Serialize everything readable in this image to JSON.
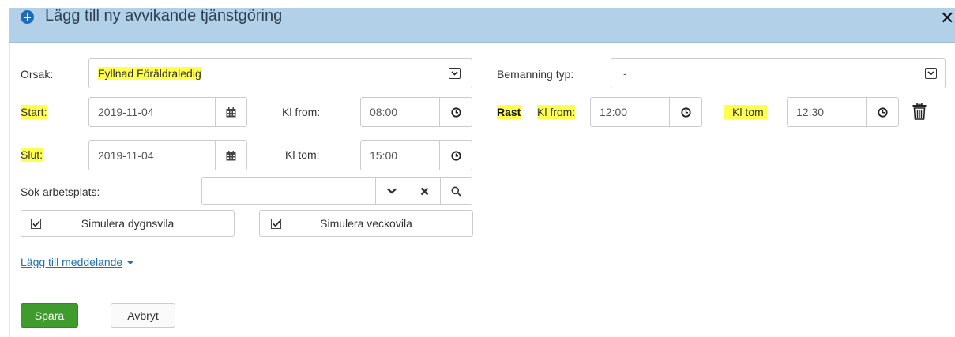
{
  "dialog": {
    "title": "Lägg till ny avvikande tjänstgöring",
    "close_glyph": "✕"
  },
  "form": {
    "orsak_label": "Orsak:",
    "orsak_value": "Fyllnad Föräldraledig",
    "bemanning_label": "Bemanning typ:",
    "bemanning_value": "-",
    "start_label": "Start:",
    "start_date": "2019-11-04",
    "start_time_label": "Kl from:",
    "start_time": "08:00",
    "rast_label": "Rast",
    "rast_from_label": "Kl from:",
    "rast_from": "12:00",
    "rast_tom_label": "Kl tom",
    "rast_tom": "12:30",
    "slut_label": "Slut:",
    "slut_date": "2019-11-04",
    "slut_time_label": "Kl tom:",
    "slut_time": "15:00",
    "workplace_label": "Sök arbetsplats:",
    "workplace_value": "",
    "simulate_dygnsvila_label": "Simulera dygnsvila",
    "simulate_dygnsvila_checked": true,
    "simulate_veckovila_label": "Simulera veckovila",
    "simulate_veckovila_checked": true,
    "add_message_link": "Lägg till meddelande"
  },
  "actions": {
    "save_label": "Spara",
    "cancel_label": "Avbryt"
  },
  "colors": {
    "header_bg": "#b2d1e8",
    "highlight": "#ffff4d",
    "save_button": "#3f9b2c",
    "link": "#1e70b3"
  }
}
